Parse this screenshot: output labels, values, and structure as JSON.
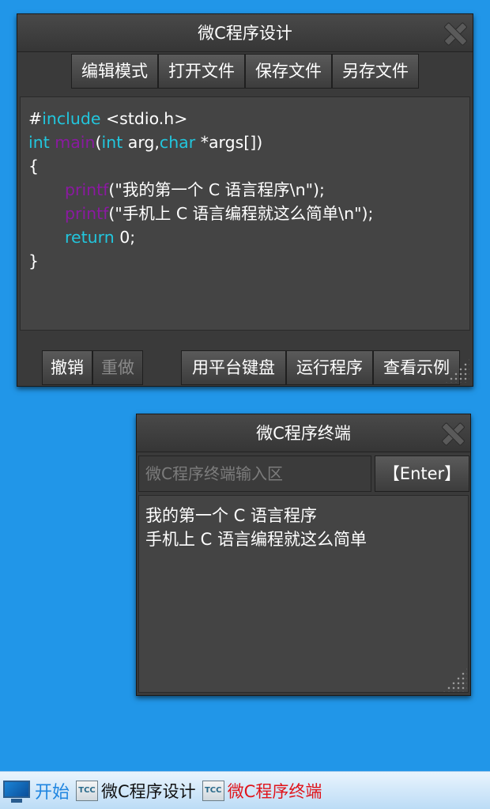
{
  "colors": {
    "desktop": "#2196e8",
    "keyword": "#22c6dd",
    "function": "#8a1aa0",
    "active_task": "#e0141b",
    "start_label": "#1f85e0"
  },
  "editor": {
    "title": "微C程序设计",
    "toolbar": {
      "edit_mode": "编辑模式",
      "open_file": "打开文件",
      "save_file": "保存文件",
      "save_as": "另存文件"
    },
    "code": {
      "l1_hash": "#",
      "l1_kw": "include",
      "l1_rest": " <stdio.h>",
      "l2_kw1": "int",
      "l2_fn": "main",
      "l2_p1": "(",
      "l2_kw2": "int",
      "l2_p2": " arg,",
      "l2_kw3": "char",
      "l2_p3": " *args[])",
      "l3": "{",
      "l4_fn": "printf",
      "l4_rest": "(\"我的第一个 C 语言程序\\n\");",
      "l5_fn": "printf",
      "l5_rest": "(\"手机上 C 语言编程就这么简单\\n\");",
      "l6_kw": "return",
      "l6_rest": " 0;",
      "l7": "}"
    },
    "undo": "撤销",
    "redo": "重做",
    "platform_keyboard": "用平台键盘",
    "run_program": "运行程序",
    "view_examples": "查看示例"
  },
  "terminal": {
    "title": "微C程序终端",
    "input_placeholder": "微C程序终端输入区",
    "enter": "【Enter】",
    "output": [
      "我的第一个 C 语言程序",
      "手机上 C 语言编程就这么简单"
    ]
  },
  "taskbar": {
    "start": "开始",
    "tasks": [
      {
        "icon": "TCC",
        "label": "微C程序设计"
      },
      {
        "icon": "TCC",
        "label": "微C程序终端"
      }
    ]
  }
}
